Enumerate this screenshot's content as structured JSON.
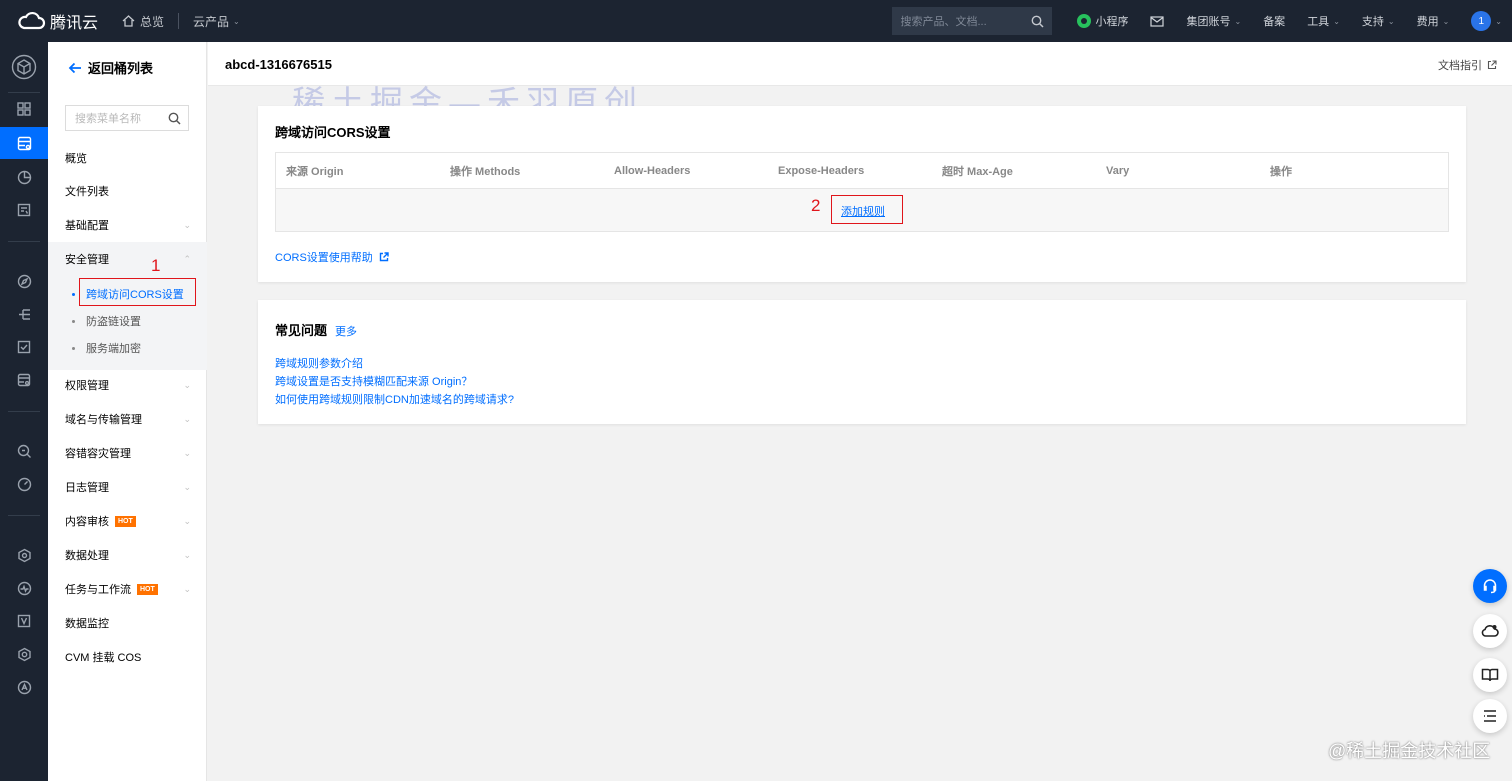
{
  "topbar": {
    "brand": "腾讯云",
    "home": "总览",
    "products": "云产品",
    "search_placeholder": "搜索产品、文档...",
    "mini_program": "小程序",
    "group_account": "集团账号",
    "filing": "备案",
    "tools": "工具",
    "support": "支持",
    "billing": "费用",
    "avatar_initial": "1"
  },
  "sidebar": {
    "back_label": "返回桶列表",
    "search_placeholder": "搜索菜单名称",
    "items": {
      "overview": "概览",
      "file_list": "文件列表",
      "basic_config": "基础配置",
      "security": "安全管理",
      "cors": "跨域访问CORS设置",
      "hotlink": "防盗链设置",
      "encryption": "服务端加密",
      "permission": "权限管理",
      "domain": "域名与传输管理",
      "disaster": "容错容灾管理",
      "log": "日志管理",
      "content_review": "内容审核",
      "data_process": "数据处理",
      "workflow": "任务与工作流",
      "monitor": "数据监控",
      "cvm_mount": "CVM 挂载 COS"
    },
    "hot_badge": "HOT"
  },
  "annotations": {
    "step1": "1",
    "step2": "2"
  },
  "header": {
    "bucket_name": "abcd-1316676515",
    "doc_guide": "文档指引"
  },
  "watermark": "稀土掘金—禾羽原创",
  "cors_card": {
    "title": "跨域访问CORS设置",
    "columns": [
      "来源 Origin",
      "操作 Methods",
      "Allow-Headers",
      "Expose-Headers",
      "超时 Max-Age",
      "Vary",
      "操作"
    ],
    "add_rule": "添加规则",
    "help_link": "CORS设置使用帮助"
  },
  "faq_card": {
    "title": "常见问题",
    "more": "更多",
    "links": [
      "跨域规则参数介绍",
      "跨域设置是否支持模糊匹配来源 Origin？",
      "如何使用跨域规则限制CDN加速域名的跨域请求?"
    ]
  },
  "credit": "@稀土掘金技术社区",
  "colors": {
    "accent": "#006eff",
    "topbar": "#1c2431",
    "annotation": "#e0151b",
    "hot": "#ff7200"
  }
}
